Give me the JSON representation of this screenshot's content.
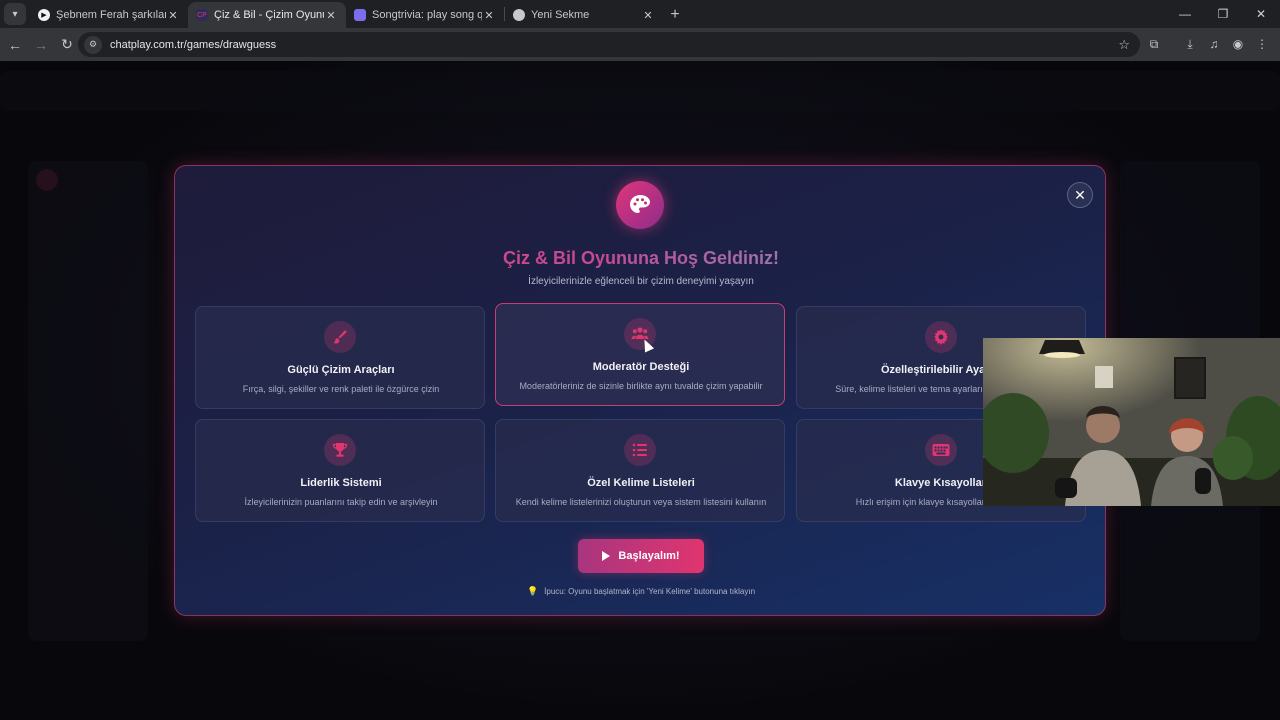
{
  "browser": {
    "tabs": [
      {
        "title": "Şebnem Ferah şarkılarını dinle ve",
        "favicon": "music-icon",
        "active": false
      },
      {
        "title": "Çiz & Bil - Çizim Oyunu",
        "favicon": "chatplay-icon",
        "active": true
      },
      {
        "title": "Songtrivia: play song quizzes and",
        "favicon": "songtrivia-icon",
        "active": false
      },
      {
        "title": "Yeni Sekme",
        "favicon": "chrome-icon",
        "active": false
      }
    ],
    "url": "chatplay.com.tr/games/drawguess"
  },
  "modal": {
    "title": "Çiz & Bil Oyununa Hoş Geldiniz!",
    "subtitle": "İzleyicilerinizle eğlenceli bir çizim deneyimi yaşayın",
    "features": [
      {
        "title": "Güçlü Çizim Araçları",
        "desc": "Fırça, silgi, şekiller ve renk paleti ile özgürce çizin",
        "icon": "brush-icon"
      },
      {
        "title": "Moderatör Desteği",
        "desc": "Moderatörleriniz de sizinle birlikte aynı tuvalde çizim yapabilir",
        "icon": "users-icon"
      },
      {
        "title": "Özelleştirilebilir Ayarlar",
        "desc": "Süre, kelime listeleri ve tema ayarlarını dilediğiniz gibi",
        "icon": "gear-icon"
      },
      {
        "title": "Liderlik Sistemi",
        "desc": "İzleyicilerinizin puanlarını takip edin ve arşivleyin",
        "icon": "trophy-icon"
      },
      {
        "title": "Özel Kelime Listeleri",
        "desc": "Kendi kelime listelerinizi oluşturun veya sistem listesini kullanın",
        "icon": "list-icon"
      },
      {
        "title": "Klavye Kısayolları",
        "desc": "Hızlı erişim için klavye kısayollarını kullanın",
        "icon": "keyboard-icon"
      }
    ],
    "start_label": "Başlayalım!",
    "tip": "İpucu: Oyunu başlatmak için 'Yeni Kelime' butonuna tıklayın"
  },
  "colors": {
    "accent": "#e0356f",
    "accent_purple": "#8e2d8c",
    "modal_bg": "#1b2147"
  }
}
